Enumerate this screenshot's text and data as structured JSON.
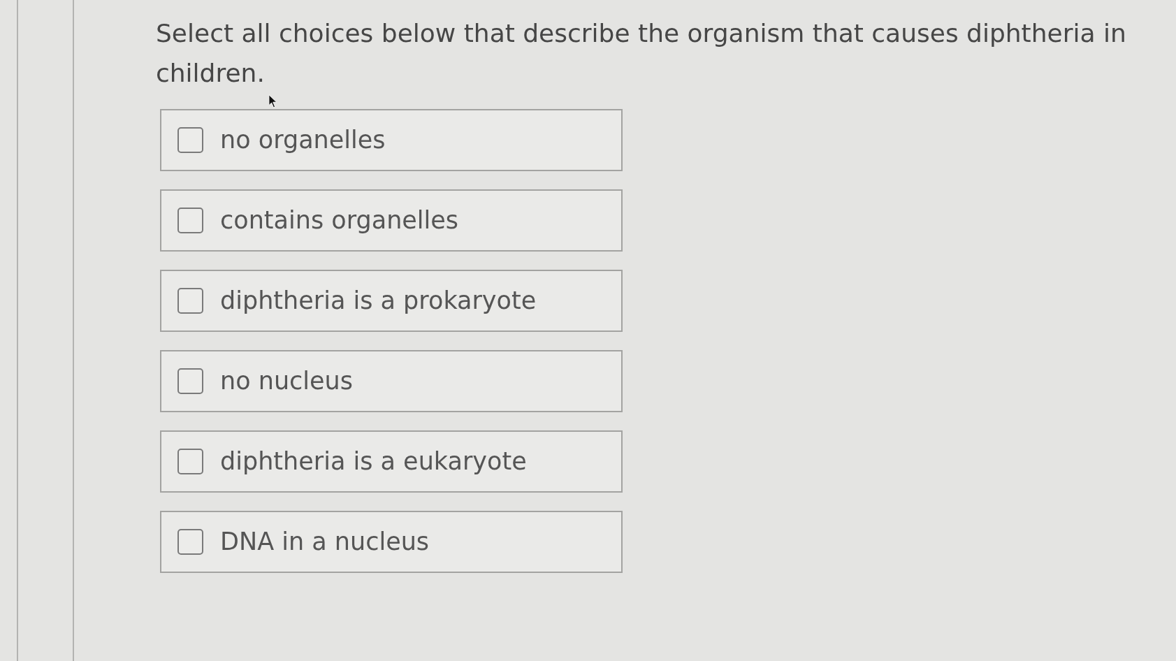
{
  "question": "Select all choices below that describe the organism that causes diphtheria in children.",
  "options": [
    {
      "label": "no organelles",
      "checked": false
    },
    {
      "label": "contains organelles",
      "checked": false
    },
    {
      "label": "diphtheria is a prokaryote",
      "checked": false
    },
    {
      "label": "no nucleus",
      "checked": false
    },
    {
      "label": "diphtheria is a eukaryote",
      "checked": false
    },
    {
      "label": "DNA in a nucleus",
      "checked": false
    }
  ]
}
